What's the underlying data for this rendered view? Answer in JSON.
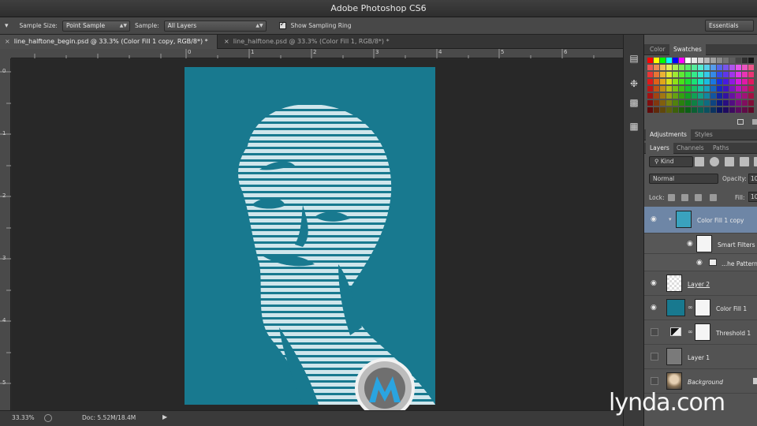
{
  "app": {
    "title": "Adobe Photoshop CS6"
  },
  "options": {
    "sample_size_label": "Sample Size:",
    "sample_size_value": "Point Sample",
    "sample_label": "Sample:",
    "sample_value": "All Layers",
    "show_ring_label": "Show Sampling Ring",
    "workspace": "Essentials"
  },
  "tabs": [
    {
      "label": "line_halftone_begin.psd @ 33.3% (Color Fill 1 copy, RGB/8*) *"
    },
    {
      "label": "line_halftone.psd @ 33.3% (Color Fill 1, RGB/8*) *"
    }
  ],
  "rulers": {
    "top": [
      "0",
      "1",
      "2",
      "3",
      "4",
      "5",
      "6"
    ],
    "left": [
      "0",
      "1",
      "2",
      "3",
      "4",
      "5"
    ]
  },
  "status": {
    "zoom": "33.33%",
    "doc": "Doc: 5.52M/18.4M"
  },
  "panels": {
    "color_tab": "Color",
    "swatches_tab": "Swatches",
    "adjustments_tab": "Adjustments",
    "styles_tab": "Styles",
    "layers_tab": "Layers",
    "channels_tab": "Channels",
    "paths_tab": "Paths",
    "kind": "Kind",
    "blend_mode": "Normal",
    "opacity_label": "Opacity:",
    "opacity_value": "10",
    "lock_label": "Lock:",
    "fill_label": "Fill:",
    "fill_value": "10"
  },
  "layers": [
    {
      "name": "Color Fill 1 copy",
      "visible": true,
      "selected": true
    },
    {
      "name": "Smart Filters",
      "visible": true
    },
    {
      "name": "...he Pattern",
      "visible": true
    },
    {
      "name": "Layer 2",
      "visible": true
    },
    {
      "name": "Color Fill 1",
      "visible": true
    },
    {
      "name": "Threshold 1",
      "visible": false
    },
    {
      "name": "Layer 1",
      "visible": false
    },
    {
      "name": "Background",
      "visible": false
    }
  ],
  "watermark": "lynda.com",
  "colors": {
    "canvas_fill": "#18798f",
    "stripes": "#cfe6ec",
    "selected_layer": "#6e86a6"
  }
}
